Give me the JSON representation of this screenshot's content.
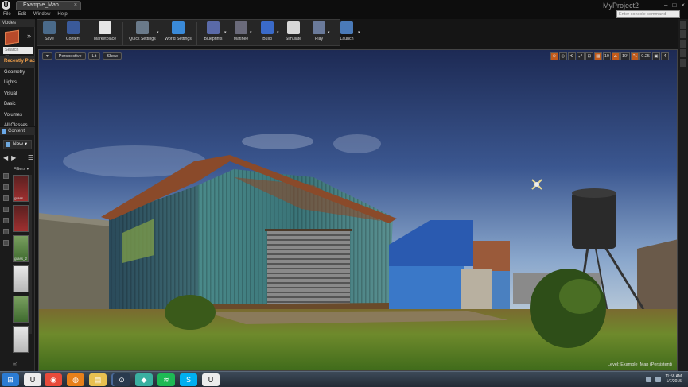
{
  "titlebar": {
    "tab_label": "Example_Map",
    "project_name": "MyProject2",
    "menus": [
      "File",
      "Edit",
      "Window",
      "Help"
    ],
    "console_placeholder": "Enter console command"
  },
  "modes": {
    "tab_label": "Modes",
    "search_placeholder": "Search Classes",
    "items": [
      {
        "label": "Recently Placed",
        "active": true
      },
      {
        "label": "Geometry",
        "active": false
      },
      {
        "label": "Lights",
        "active": false
      },
      {
        "label": "Visual",
        "active": false
      },
      {
        "label": "Basic",
        "active": false
      },
      {
        "label": "Volumes",
        "active": false
      },
      {
        "label": "All Classes",
        "active": false
      }
    ]
  },
  "content_browser": {
    "tab_label": "Content",
    "new_label": "New",
    "filters_label": "Filters",
    "thumb_labels": [
      "grass",
      "",
      "grass_2",
      "",
      "",
      ""
    ],
    "view_options": "◎"
  },
  "toolbar": {
    "buttons": [
      {
        "label": "Save",
        "icon": "save-icon",
        "color": "#4a6a8a",
        "dropdown": false
      },
      {
        "label": "Content",
        "icon": "content-icon",
        "color": "#3a5a9a",
        "dropdown": false
      },
      {
        "label": "Marketplace",
        "icon": "marketplace-icon",
        "color": "#e6e6e6",
        "dropdown": false
      },
      {
        "label": "Quick Settings",
        "icon": "quick-settings-icon",
        "color": "#6a7a8a",
        "dropdown": true
      },
      {
        "label": "World Settings",
        "icon": "world-settings-icon",
        "color": "#3a8ad8",
        "dropdown": false
      },
      {
        "label": "Blueprints",
        "icon": "blueprints-icon",
        "color": "#5a6aa8",
        "dropdown": true
      },
      {
        "label": "Matinee",
        "icon": "matinee-icon",
        "color": "#6a6a7a",
        "dropdown": true
      },
      {
        "label": "Build",
        "icon": "build-icon",
        "color": "#3a6ac8",
        "dropdown": true
      },
      {
        "label": "Simulate",
        "icon": "simulate-icon",
        "color": "#d8d8d8",
        "dropdown": false
      },
      {
        "label": "Play",
        "icon": "play-icon",
        "color": "#6a7a9a",
        "dropdown": true
      },
      {
        "label": "Launch",
        "icon": "launch-icon",
        "color": "#4a7ab8",
        "dropdown": true
      }
    ]
  },
  "viewport": {
    "menu_caret": "▾",
    "view_mode": "Perspective",
    "lighting": "Lit",
    "show": "Show",
    "tools": [
      {
        "label": "⊕",
        "orange": true
      },
      {
        "label": "◎",
        "orange": false
      },
      {
        "label": "⟲",
        "orange": false
      },
      {
        "label": "⤢",
        "orange": false
      },
      {
        "label": "⊞",
        "orange": false
      },
      {
        "label": "▦",
        "orange": true
      },
      {
        "label": "10",
        "orange": false
      },
      {
        "label": "∠",
        "orange": true
      },
      {
        "label": "10°",
        "orange": false
      },
      {
        "label": "⤡",
        "orange": true
      },
      {
        "label": "0.25",
        "orange": false
      },
      {
        "label": "▣",
        "orange": false
      },
      {
        "label": "4",
        "orange": false
      }
    ],
    "level_label": "Level: Example_Map (Persistent)"
  },
  "taskbar": {
    "apps": [
      {
        "icon": "windows-start-icon",
        "color": "#2b7cd3",
        "glyph": "⊞"
      },
      {
        "icon": "unreal-icon",
        "color": "#ececec",
        "glyph": "U"
      },
      {
        "icon": "chrome-icon",
        "color": "#e84a3a",
        "glyph": "◉"
      },
      {
        "icon": "firefox-icon",
        "color": "#e8801a",
        "glyph": "◍"
      },
      {
        "icon": "folder-icon",
        "color": "#e8c050",
        "glyph": "▤"
      },
      {
        "icon": "explorer-icon",
        "color": "#4a6a9a",
        "glyph": "▣"
      },
      {
        "icon": "steam-icon",
        "color": "#2a3a4e",
        "glyph": "⊙"
      },
      {
        "icon": "app-icon",
        "color": "#3ab0a0",
        "glyph": "◆"
      },
      {
        "icon": "spotify-icon",
        "color": "#1db954",
        "glyph": "≋"
      },
      {
        "icon": "skype-icon",
        "color": "#00aff0",
        "glyph": "S"
      },
      {
        "icon": "unreal-launcher-icon",
        "color": "#ececec",
        "glyph": "U"
      }
    ],
    "time": "11:58 AM",
    "date": "1/7/2015"
  }
}
